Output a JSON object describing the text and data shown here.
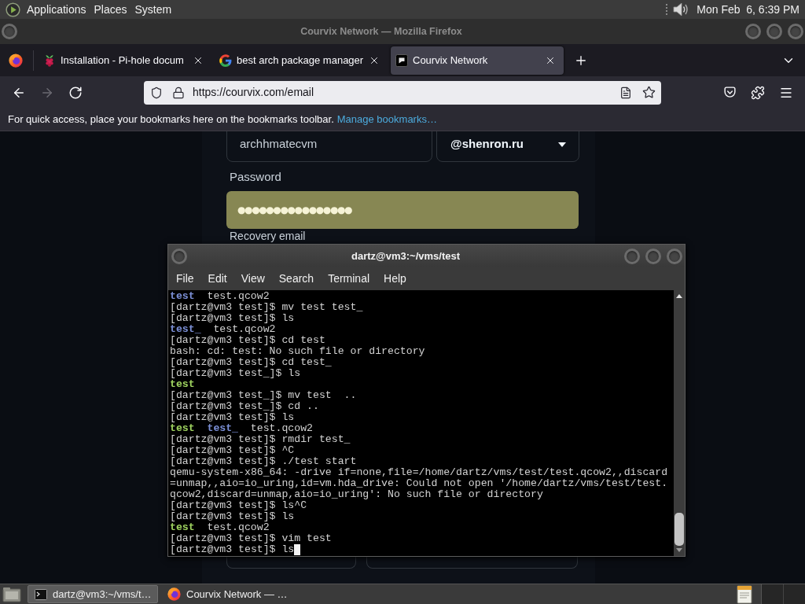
{
  "top_panel": {
    "menus": [
      "Applications",
      "Places",
      "System"
    ],
    "clock": "Mon Feb  6, 6:39 PM"
  },
  "browser": {
    "title": "Courvix Network — Mozilla Firefox",
    "tabs": [
      {
        "title": "Installation - Pi-hole docum",
        "kind": "raspberry",
        "selected": false
      },
      {
        "title": "best arch package manager",
        "kind": "google",
        "selected": false
      },
      {
        "title": "Courvix Network",
        "kind": "site",
        "selected": true
      }
    ],
    "nav_buttons": [
      {
        "kind": "back",
        "disabled": false
      },
      {
        "kind": "forward",
        "disabled": true
      },
      {
        "kind": "reload",
        "disabled": false
      }
    ],
    "url": "https://courvix.com/email",
    "bookmarks_bar": {
      "message": "For quick access, place your bookmarks here on the bookmarks toolbar.",
      "link": "Manage bookmarks…"
    }
  },
  "page": {
    "username": "archhmatecvm",
    "domain": "@shenron.ru",
    "password_label": "Password",
    "password": "●●●●●●●●●●●●●●●●",
    "password_autofilled": true,
    "recovery_label": "Recovery email"
  },
  "terminal": {
    "title": "dartz@vm3:~/vms/test",
    "menus": [
      "File",
      "Edit",
      "View",
      "Search",
      "Terminal",
      "Help"
    ],
    "lines": [
      {
        "kind": "listing",
        "entries": [
          {
            "name": "test",
            "kind": "directory"
          },
          {
            "name": "test.qcow2",
            "kind": "file"
          }
        ]
      },
      {
        "kind": "text",
        "text": "[dartz@vm3 test]$ mv test test_"
      },
      {
        "kind": "text",
        "text": "[dartz@vm3 test]$ ls"
      },
      {
        "kind": "listing",
        "entries": [
          {
            "name": "test_",
            "kind": "directory"
          },
          {
            "name": "test.qcow2",
            "kind": "file"
          }
        ]
      },
      {
        "kind": "text",
        "text": "[dartz@vm3 test]$ cd test"
      },
      {
        "kind": "text",
        "text": "bash: cd: test: No such file or directory"
      },
      {
        "kind": "text",
        "text": "[dartz@vm3 test]$ cd test_"
      },
      {
        "kind": "text",
        "text": "[dartz@vm3 test_]$ ls"
      },
      {
        "kind": "listing",
        "entries": [
          {
            "name": "test",
            "kind": "executable"
          }
        ]
      },
      {
        "kind": "text",
        "text": "[dartz@vm3 test_]$ mv test  .."
      },
      {
        "kind": "text",
        "text": "[dartz@vm3 test_]$ cd .."
      },
      {
        "kind": "text",
        "text": "[dartz@vm3 test]$ ls"
      },
      {
        "kind": "listing",
        "entries": [
          {
            "name": "test",
            "kind": "executable"
          },
          {
            "name": "test_",
            "kind": "directory"
          },
          {
            "name": "test.qcow2",
            "kind": "file"
          }
        ]
      },
      {
        "kind": "text",
        "text": "[dartz@vm3 test]$ rmdir test_"
      },
      {
        "kind": "text",
        "text": "[dartz@vm3 test]$ ^C"
      },
      {
        "kind": "text",
        "text": "[dartz@vm3 test]$ ./test start"
      },
      {
        "kind": "text",
        "text": "qemu-system-x86_64: -drive if=none,file=/home/dartz/vms/test/test.qcow2,,discard"
      },
      {
        "kind": "text",
        "text": "=unmap,,aio=io_uring,id=vm.hda_drive: Could not open '/home/dartz/vms/test/test."
      },
      {
        "kind": "text",
        "text": "qcow2,discard=unmap,aio=io_uring': No such file or directory"
      },
      {
        "kind": "text",
        "text": "[dartz@vm3 test]$ ls^C"
      },
      {
        "kind": "text",
        "text": "[dartz@vm3 test]$ ls"
      },
      {
        "kind": "listing",
        "entries": [
          {
            "name": "test",
            "kind": "executable"
          },
          {
            "name": "test.qcow2",
            "kind": "file"
          }
        ]
      },
      {
        "kind": "text",
        "text": "[dartz@vm3 test]$ vim test"
      },
      {
        "kind": "text",
        "text": "[dartz@vm3 test]$ ls"
      }
    ],
    "cursor": true
  },
  "taskbar": {
    "tasks": [
      {
        "label": "dartz@vm3:~/vms/t…",
        "kind": "terminal",
        "selected": true
      },
      {
        "label": "Courvix Network — …",
        "kind": "firefox",
        "selected": false
      }
    ]
  }
}
